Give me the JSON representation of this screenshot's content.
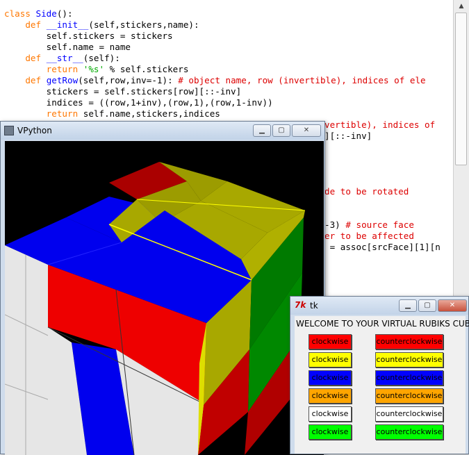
{
  "editor": {
    "lines": [
      {
        "indent": "",
        "tokens": [
          [
            "kw",
            "class "
          ],
          [
            "fn",
            "Side"
          ],
          [
            "",
            "():"
          ]
        ]
      },
      {
        "indent": "    ",
        "tokens": [
          [
            "kw",
            "def "
          ],
          [
            "fn",
            "__init__"
          ],
          [
            "",
            "(self,stickers,name):"
          ]
        ]
      },
      {
        "indent": "        ",
        "tokens": [
          [
            "",
            "self.stickers = stickers"
          ]
        ]
      },
      {
        "indent": "        ",
        "tokens": [
          [
            "",
            "self.name = name"
          ]
        ]
      },
      {
        "indent": "    ",
        "tokens": [
          [
            "kw",
            "def "
          ],
          [
            "fn",
            "__str__"
          ],
          [
            "",
            "(self):"
          ]
        ]
      },
      {
        "indent": "        ",
        "tokens": [
          [
            "kw",
            "return "
          ],
          [
            "st",
            "'%s'"
          ],
          [
            "",
            " % self.stickers"
          ]
        ]
      },
      {
        "indent": "    ",
        "tokens": [
          [
            "kw",
            "def "
          ],
          [
            "fn",
            "getRow"
          ],
          [
            "",
            "(self,row,inv=-1): "
          ],
          [
            "cm",
            "# object name, row (invertible), indices of ele"
          ]
        ]
      },
      {
        "indent": "        ",
        "tokens": [
          [
            "",
            "stickers = self.stickers[row][::-inv]"
          ]
        ]
      },
      {
        "indent": "        ",
        "tokens": [
          [
            "",
            "indices = ((row,1+inv),(row,1),(row,1-inv))"
          ]
        ]
      },
      {
        "indent": "        ",
        "tokens": [
          [
            "kw",
            "return "
          ],
          [
            "",
            "self.name,stickers,indices"
          ]
        ]
      }
    ],
    "right_lines": [
      {
        "tokens": [
          [
            "cm",
            "vertible), indices of"
          ]
        ]
      },
      {
        "tokens": [
          [
            "",
            "][::-inv]"
          ]
        ]
      },
      {
        "tokens": [
          [
            "",
            ""
          ]
        ]
      },
      {
        "tokens": [
          [
            "",
            ""
          ]
        ]
      },
      {
        "tokens": [
          [
            "",
            ""
          ]
        ]
      },
      {
        "tokens": [
          [
            "",
            ""
          ]
        ]
      },
      {
        "tokens": [
          [
            "cm",
            "de to be rotated"
          ]
        ]
      },
      {
        "tokens": [
          [
            "",
            ""
          ]
        ]
      },
      {
        "tokens": [
          [
            "",
            ""
          ]
        ]
      },
      {
        "tokens": [
          [
            "",
            "-3) "
          ],
          [
            "cm",
            "# source face"
          ]
        ]
      },
      {
        "tokens": [
          [
            "cm",
            "er to be affected"
          ]
        ]
      },
      {
        "tokens": [
          [
            "",
            " = assoc[srcFace][1][n"
          ]
        ]
      }
    ]
  },
  "vpython": {
    "title": "VPython",
    "min_icon": "minimize-icon",
    "max_icon": "maximize-icon",
    "close_icon": "close-icon"
  },
  "tk": {
    "title": "tk",
    "heading": "WELCOME TO YOUR VIRTUAL RUBIKS CUBE",
    "rows": [
      {
        "color": "#ff0000",
        "text_color": "#000000",
        "cw": "clockwise",
        "ccw": "counterclockwise"
      },
      {
        "color": "#ffff00",
        "text_color": "#000000",
        "cw": "clockwise",
        "ccw": "counterclockwise"
      },
      {
        "color": "#0000ff",
        "text_color": "#000000",
        "cw": "clockwise",
        "ccw": "counterclockwise"
      },
      {
        "color": "#ffa500",
        "text_color": "#000000",
        "cw": "clockwise",
        "ccw": "counterclockwise"
      },
      {
        "color": "#ffffff",
        "text_color": "#000000",
        "cw": "clockwise",
        "ccw": "counterclockwise"
      },
      {
        "color": "#00ff00",
        "text_color": "#000000",
        "cw": "clockwise",
        "ccw": "counterclockwise"
      }
    ]
  },
  "cube_colors": {
    "red": "#ee0000",
    "blue": "#0000ee",
    "yellow": "#b5b500",
    "green": "#007a00",
    "white": "#e8e8e8",
    "dark_red": "#9a0000"
  }
}
